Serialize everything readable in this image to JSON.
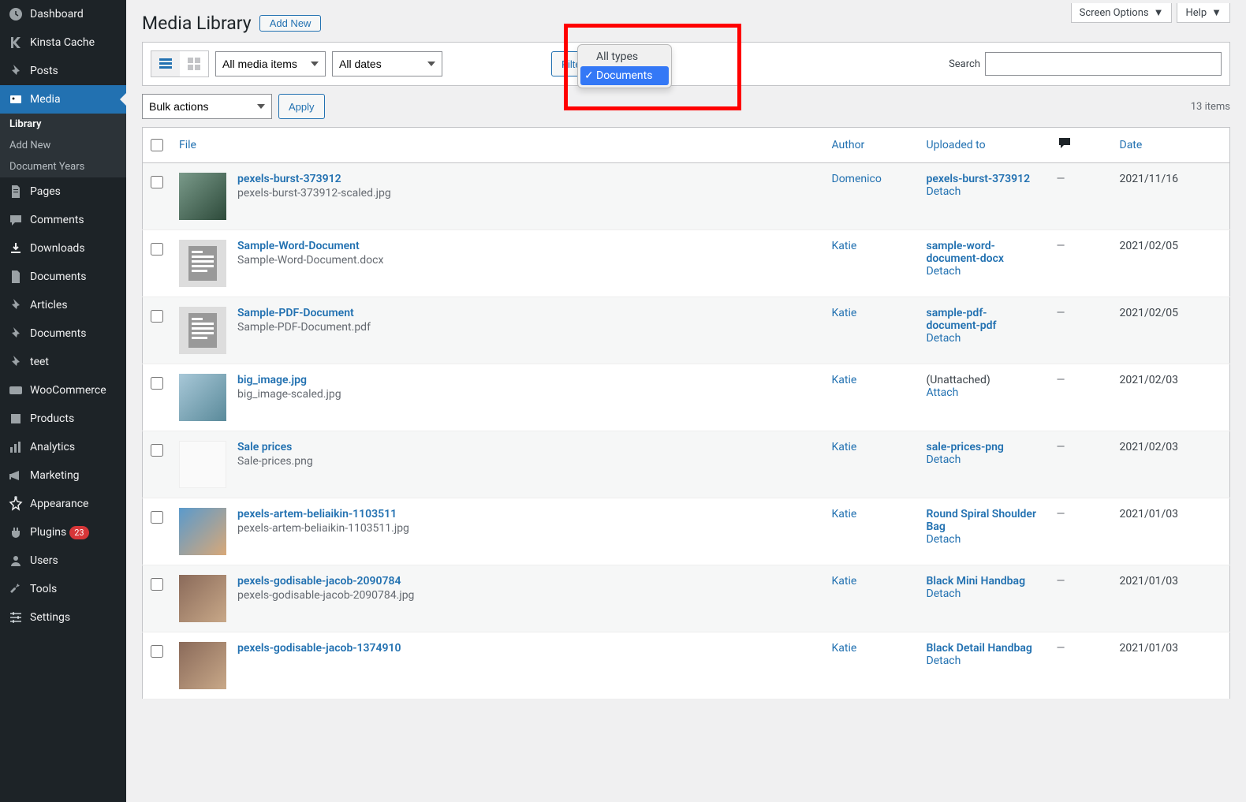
{
  "top_controls": {
    "screen_options": "Screen Options",
    "help": "Help"
  },
  "sidebar": {
    "items": [
      {
        "label": "Dashboard",
        "icon": "dashboard"
      },
      {
        "label": "Kinsta Cache",
        "icon": "kinsta"
      },
      {
        "label": "Posts",
        "icon": "pin"
      },
      {
        "label": "Media",
        "icon": "media",
        "current": true,
        "subitems": [
          {
            "label": "Library",
            "current": true
          },
          {
            "label": "Add New"
          },
          {
            "label": "Document Years"
          }
        ]
      },
      {
        "label": "Pages",
        "icon": "pages"
      },
      {
        "label": "Comments",
        "icon": "comments"
      },
      {
        "label": "Downloads",
        "icon": "download"
      },
      {
        "label": "Documents",
        "icon": "documents"
      },
      {
        "label": "Articles",
        "icon": "pin"
      },
      {
        "label": "Documents",
        "icon": "pin"
      },
      {
        "label": "teet",
        "icon": "pin"
      },
      {
        "label": "WooCommerce",
        "icon": "woo"
      },
      {
        "label": "Products",
        "icon": "products"
      },
      {
        "label": "Analytics",
        "icon": "analytics"
      },
      {
        "label": "Marketing",
        "icon": "marketing"
      },
      {
        "label": "Appearance",
        "icon": "appearance"
      },
      {
        "label": "Plugins",
        "icon": "plugins",
        "badge": "23"
      },
      {
        "label": "Users",
        "icon": "users"
      },
      {
        "label": "Tools",
        "icon": "tools"
      },
      {
        "label": "Settings",
        "icon": "settings"
      }
    ]
  },
  "page": {
    "title": "Media Library",
    "add_new": "Add New"
  },
  "filters": {
    "media_items": "All media items",
    "dates": "All dates",
    "type_popup": {
      "option1": "All types",
      "option2": "Documents"
    },
    "filter_btn": "Filter",
    "search_label": "Search"
  },
  "bulk": {
    "actions": "Bulk actions",
    "apply": "Apply",
    "count": "13 items"
  },
  "columns": {
    "file": "File",
    "author": "Author",
    "uploaded": "Uploaded to",
    "date": "Date"
  },
  "detach_label": "Detach",
  "attach_label": "Attach",
  "unattached_label": "(Unattached)",
  "rows": [
    {
      "title": "pexels-burst-373912",
      "filename": "pexels-burst-373912-scaled.jpg",
      "author": "Domenico",
      "uploaded": "pexels-burst-373912",
      "detach": true,
      "comments": "—",
      "date": "2021/11/16",
      "thumb": "photo1"
    },
    {
      "title": "Sample-Word-Document",
      "filename": "Sample-Word-Document.docx",
      "author": "Katie",
      "uploaded": "sample-word-document-docx",
      "detach": true,
      "comments": "—",
      "date": "2021/02/05",
      "thumb": "doc"
    },
    {
      "title": "Sample-PDF-Document",
      "filename": "Sample-PDF-Document.pdf",
      "author": "Katie",
      "uploaded": "sample-pdf-document-pdf",
      "detach": true,
      "comments": "—",
      "date": "2021/02/05",
      "thumb": "doc"
    },
    {
      "title": "big_image.jpg",
      "filename": "big_image-scaled.jpg",
      "author": "Katie",
      "uploaded": "",
      "detach": false,
      "comments": "—",
      "date": "2021/02/03",
      "thumb": "photo2"
    },
    {
      "title": "Sale prices",
      "filename": "Sale-prices.png",
      "author": "Katie",
      "uploaded": "sale-prices-png",
      "detach": true,
      "comments": "—",
      "date": "2021/02/03",
      "thumb": "white"
    },
    {
      "title": "pexels-artem-beliaikin-1103511",
      "filename": "pexels-artem-beliaikin-1103511.jpg",
      "author": "Katie",
      "uploaded": "Round Spiral Shoulder Bag",
      "detach": true,
      "comments": "—",
      "date": "2021/01/03",
      "thumb": "photo3"
    },
    {
      "title": "pexels-godisable-jacob-2090784",
      "filename": "pexels-godisable-jacob-2090784.jpg",
      "author": "Katie",
      "uploaded": "Black Mini Handbag",
      "detach": true,
      "comments": "—",
      "date": "2021/01/03",
      "thumb": "photo4"
    },
    {
      "title": "pexels-godisable-jacob-1374910",
      "filename": "",
      "author": "Katie",
      "uploaded": "Black Detail Handbag",
      "detach": true,
      "comments": "—",
      "date": "2021/01/03",
      "thumb": "photo4"
    }
  ]
}
